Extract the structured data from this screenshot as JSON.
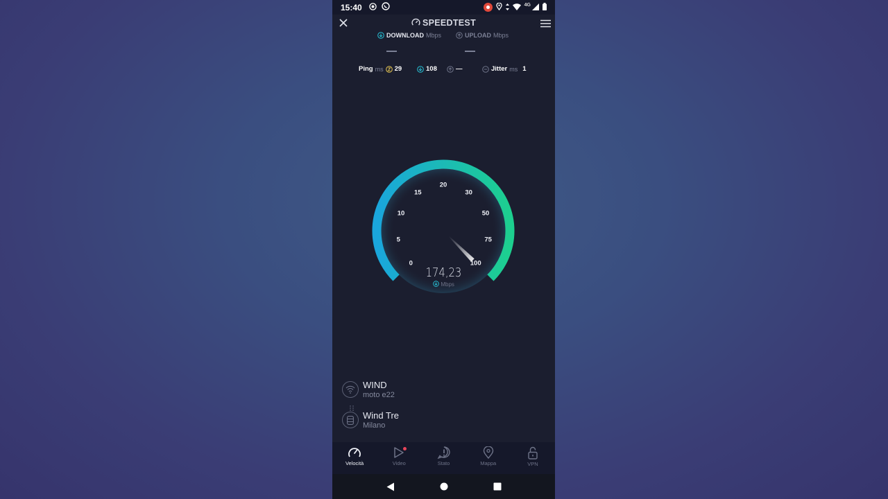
{
  "status_bar": {
    "time": "15:40",
    "network_type": "4G",
    "icons": [
      "record-icon",
      "whatsapp-icon",
      "screen-record-icon",
      "location-icon",
      "data-arrows-icon",
      "wifi-icon",
      "signal-icon",
      "battery-icon"
    ]
  },
  "app": {
    "brand": "SPEEDTEST"
  },
  "tabs": {
    "download_label": "DOWNLOAD",
    "download_unit": "Mbps",
    "upload_label": "UPLOAD",
    "upload_unit": "Mbps"
  },
  "stats": {
    "ping_label": "Ping",
    "ping_unit": "ms",
    "ping_idle": "29",
    "ping_download": "108",
    "ping_upload": "—",
    "jitter_label": "Jitter",
    "jitter_unit": "ms",
    "jitter_value": "1"
  },
  "gauge": {
    "ticks": [
      "0",
      "5",
      "10",
      "15",
      "20",
      "30",
      "50",
      "75",
      "100"
    ],
    "speed_value": "174,23",
    "speed_unit": "Mbps",
    "needle_value": 100,
    "colors": {
      "start": "#1aa6dc",
      "end": "#1dcf8f"
    }
  },
  "connection": {
    "provider_name": "WIND",
    "device": "moto e22",
    "server_name": "Wind Tre",
    "server_city": "Milano"
  },
  "bottom_nav": [
    {
      "label": "Velocità",
      "icon": "speedometer-icon",
      "active": true
    },
    {
      "label": "Video",
      "icon": "play-icon",
      "active": false
    },
    {
      "label": "Stato",
      "icon": "alert-icon",
      "active": false
    },
    {
      "label": "Mappa",
      "icon": "map-pin-icon",
      "active": false
    },
    {
      "label": "VPN",
      "icon": "lock-open-icon",
      "active": false
    }
  ]
}
